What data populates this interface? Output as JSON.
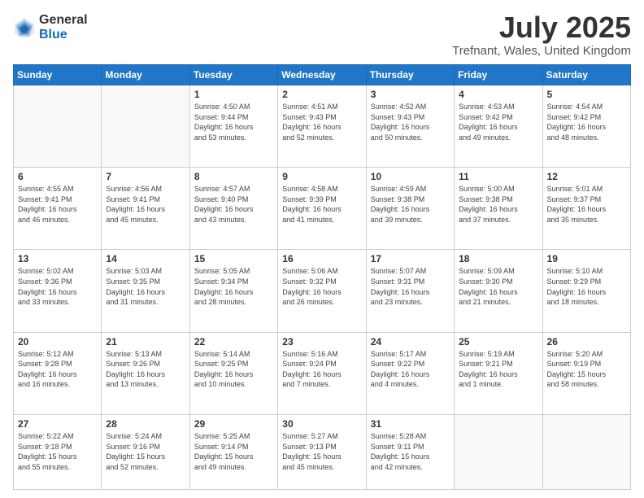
{
  "logo": {
    "general": "General",
    "blue": "Blue"
  },
  "header": {
    "month": "July 2025",
    "location": "Trefnant, Wales, United Kingdom"
  },
  "days_of_week": [
    "Sunday",
    "Monday",
    "Tuesday",
    "Wednesday",
    "Thursday",
    "Friday",
    "Saturday"
  ],
  "weeks": [
    [
      {
        "day": "",
        "info": ""
      },
      {
        "day": "",
        "info": ""
      },
      {
        "day": "1",
        "info": "Sunrise: 4:50 AM\nSunset: 9:44 PM\nDaylight: 16 hours\nand 53 minutes."
      },
      {
        "day": "2",
        "info": "Sunrise: 4:51 AM\nSunset: 9:43 PM\nDaylight: 16 hours\nand 52 minutes."
      },
      {
        "day": "3",
        "info": "Sunrise: 4:52 AM\nSunset: 9:43 PM\nDaylight: 16 hours\nand 50 minutes."
      },
      {
        "day": "4",
        "info": "Sunrise: 4:53 AM\nSunset: 9:42 PM\nDaylight: 16 hours\nand 49 minutes."
      },
      {
        "day": "5",
        "info": "Sunrise: 4:54 AM\nSunset: 9:42 PM\nDaylight: 16 hours\nand 48 minutes."
      }
    ],
    [
      {
        "day": "6",
        "info": "Sunrise: 4:55 AM\nSunset: 9:41 PM\nDaylight: 16 hours\nand 46 minutes."
      },
      {
        "day": "7",
        "info": "Sunrise: 4:56 AM\nSunset: 9:41 PM\nDaylight: 16 hours\nand 45 minutes."
      },
      {
        "day": "8",
        "info": "Sunrise: 4:57 AM\nSunset: 9:40 PM\nDaylight: 16 hours\nand 43 minutes."
      },
      {
        "day": "9",
        "info": "Sunrise: 4:58 AM\nSunset: 9:39 PM\nDaylight: 16 hours\nand 41 minutes."
      },
      {
        "day": "10",
        "info": "Sunrise: 4:59 AM\nSunset: 9:38 PM\nDaylight: 16 hours\nand 39 minutes."
      },
      {
        "day": "11",
        "info": "Sunrise: 5:00 AM\nSunset: 9:38 PM\nDaylight: 16 hours\nand 37 minutes."
      },
      {
        "day": "12",
        "info": "Sunrise: 5:01 AM\nSunset: 9:37 PM\nDaylight: 16 hours\nand 35 minutes."
      }
    ],
    [
      {
        "day": "13",
        "info": "Sunrise: 5:02 AM\nSunset: 9:36 PM\nDaylight: 16 hours\nand 33 minutes."
      },
      {
        "day": "14",
        "info": "Sunrise: 5:03 AM\nSunset: 9:35 PM\nDaylight: 16 hours\nand 31 minutes."
      },
      {
        "day": "15",
        "info": "Sunrise: 5:05 AM\nSunset: 9:34 PM\nDaylight: 16 hours\nand 28 minutes."
      },
      {
        "day": "16",
        "info": "Sunrise: 5:06 AM\nSunset: 9:32 PM\nDaylight: 16 hours\nand 26 minutes."
      },
      {
        "day": "17",
        "info": "Sunrise: 5:07 AM\nSunset: 9:31 PM\nDaylight: 16 hours\nand 23 minutes."
      },
      {
        "day": "18",
        "info": "Sunrise: 5:09 AM\nSunset: 9:30 PM\nDaylight: 16 hours\nand 21 minutes."
      },
      {
        "day": "19",
        "info": "Sunrise: 5:10 AM\nSunset: 9:29 PM\nDaylight: 16 hours\nand 18 minutes."
      }
    ],
    [
      {
        "day": "20",
        "info": "Sunrise: 5:12 AM\nSunset: 9:28 PM\nDaylight: 16 hours\nand 16 minutes."
      },
      {
        "day": "21",
        "info": "Sunrise: 5:13 AM\nSunset: 9:26 PM\nDaylight: 16 hours\nand 13 minutes."
      },
      {
        "day": "22",
        "info": "Sunrise: 5:14 AM\nSunset: 9:25 PM\nDaylight: 16 hours\nand 10 minutes."
      },
      {
        "day": "23",
        "info": "Sunrise: 5:16 AM\nSunset: 9:24 PM\nDaylight: 16 hours\nand 7 minutes."
      },
      {
        "day": "24",
        "info": "Sunrise: 5:17 AM\nSunset: 9:22 PM\nDaylight: 16 hours\nand 4 minutes."
      },
      {
        "day": "25",
        "info": "Sunrise: 5:19 AM\nSunset: 9:21 PM\nDaylight: 16 hours\nand 1 minute."
      },
      {
        "day": "26",
        "info": "Sunrise: 5:20 AM\nSunset: 9:19 PM\nDaylight: 15 hours\nand 58 minutes."
      }
    ],
    [
      {
        "day": "27",
        "info": "Sunrise: 5:22 AM\nSunset: 9:18 PM\nDaylight: 15 hours\nand 55 minutes."
      },
      {
        "day": "28",
        "info": "Sunrise: 5:24 AM\nSunset: 9:16 PM\nDaylight: 15 hours\nand 52 minutes."
      },
      {
        "day": "29",
        "info": "Sunrise: 5:25 AM\nSunset: 9:14 PM\nDaylight: 15 hours\nand 49 minutes."
      },
      {
        "day": "30",
        "info": "Sunrise: 5:27 AM\nSunset: 9:13 PM\nDaylight: 15 hours\nand 45 minutes."
      },
      {
        "day": "31",
        "info": "Sunrise: 5:28 AM\nSunset: 9:11 PM\nDaylight: 15 hours\nand 42 minutes."
      },
      {
        "day": "",
        "info": ""
      },
      {
        "day": "",
        "info": ""
      }
    ]
  ]
}
